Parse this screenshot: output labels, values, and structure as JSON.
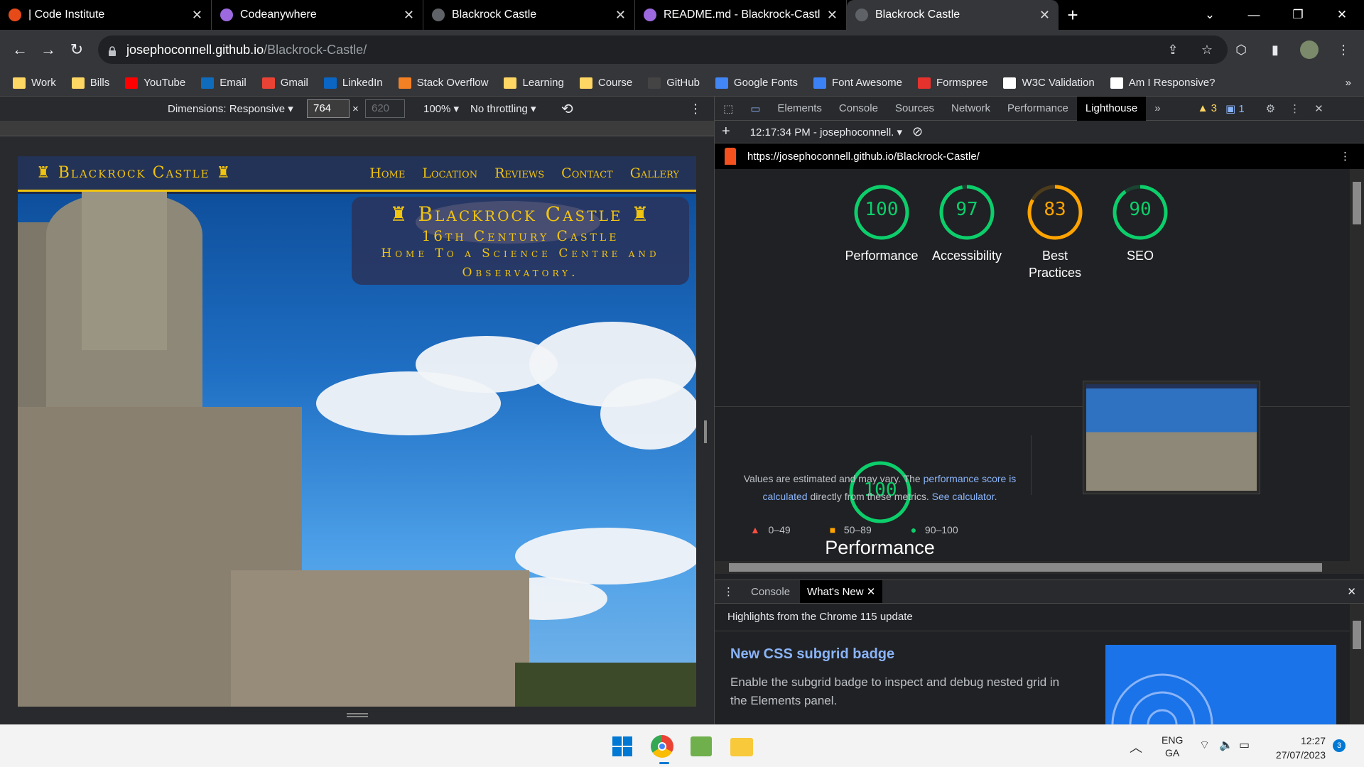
{
  "browser": {
    "tabs": [
      {
        "title": "| Code Institute",
        "fav_color": "#e64a19",
        "active": false
      },
      {
        "title": "Codeanywhere",
        "fav_color": "#9c6ade",
        "active": false
      },
      {
        "title": "Blackrock Castle",
        "fav_color": "#9aa0a6",
        "active": false
      },
      {
        "title": "README.md - Blackrock-Castle -",
        "fav_color": "#9c6ade",
        "active": false
      },
      {
        "title": "Blackrock Castle",
        "fav_color": "#9aa0a6",
        "active": true
      }
    ],
    "url_host": "josephoconnell.github.io",
    "url_path": "/Blackrock-Castle/",
    "bookmarks": [
      {
        "label": "Work",
        "icon": "folder-icon"
      },
      {
        "label": "Bills",
        "icon": "folder-icon"
      },
      {
        "label": "YouTube",
        "icon": "youtube-icon"
      },
      {
        "label": "Email",
        "icon": "outlook-icon"
      },
      {
        "label": "Gmail",
        "icon": "gmail-icon"
      },
      {
        "label": "LinkedIn",
        "icon": "linkedin-icon"
      },
      {
        "label": "Stack Overflow",
        "icon": "stackoverflow-icon"
      },
      {
        "label": "Learning",
        "icon": "folder-icon"
      },
      {
        "label": "Course",
        "icon": "folder-icon"
      },
      {
        "label": "GitHub",
        "icon": "github-icon"
      },
      {
        "label": "Google Fonts",
        "icon": "google-fonts-icon"
      },
      {
        "label": "Font Awesome",
        "icon": "flag-icon"
      },
      {
        "label": "Formspree",
        "icon": "formspree-icon"
      },
      {
        "label": "W3C Validation",
        "icon": "w3c-icon"
      },
      {
        "label": "Am I Responsive?",
        "icon": "amiresponsive-icon"
      }
    ]
  },
  "device_toolbar": {
    "dimensions": "Dimensions: Responsive",
    "width": "764",
    "height_placeholder": "620",
    "zoom": "100%",
    "throttle": "No throttling"
  },
  "site": {
    "brand": "Blackrock Castle",
    "nav": [
      "Home",
      "Location",
      "Reviews",
      "Contact",
      "Gallery"
    ],
    "hero_title": "Blackrock Castle",
    "hero_sub": "16th Century Castle",
    "hero_text": "Home To a Science Centre and Observatory."
  },
  "devtools": {
    "tabs": [
      "Elements",
      "Console",
      "Sources",
      "Network",
      "Performance",
      "Lighthouse"
    ],
    "active_tab": "Lighthouse",
    "warnings": "3",
    "messages": "1",
    "report_time": "12:17:34 PM - josephoconnell.",
    "report_url": "https://josephoconnell.github.io/Blackrock-Castle/",
    "scores": [
      {
        "label": "Performance",
        "value": "100",
        "score": 1.0,
        "color": "#0cce6b"
      },
      {
        "label": "Accessibility",
        "value": "97",
        "score": 0.97,
        "color": "#0cce6b"
      },
      {
        "label": "Best Practices",
        "value": "83",
        "score": 0.83,
        "color": "#ffa400"
      },
      {
        "label": "SEO",
        "value": "90",
        "score": 0.9,
        "color": "#0cce6b"
      }
    ],
    "perf_value": "100",
    "perf_title": "Performance",
    "perf_desc_1": "Values are estimated and may vary. The ",
    "perf_link_1": "performance score is calculated",
    "perf_desc_2": " directly from these metrics. ",
    "perf_link_2": "See calculator.",
    "legend": [
      "0–49",
      "50–89",
      "90–100"
    ],
    "drawer_tabs": [
      "Console",
      "What's New"
    ],
    "highlights": "Highlights from the Chrome 115 update",
    "news_title": "New CSS subgrid badge",
    "news_body": "Enable the subgrid badge to inspect and debug nested grid in the Elements panel."
  },
  "taskbar": {
    "lang": "ENG",
    "lang2": "GA",
    "time": "12:27",
    "date": "27/07/2023",
    "notif": "3"
  }
}
